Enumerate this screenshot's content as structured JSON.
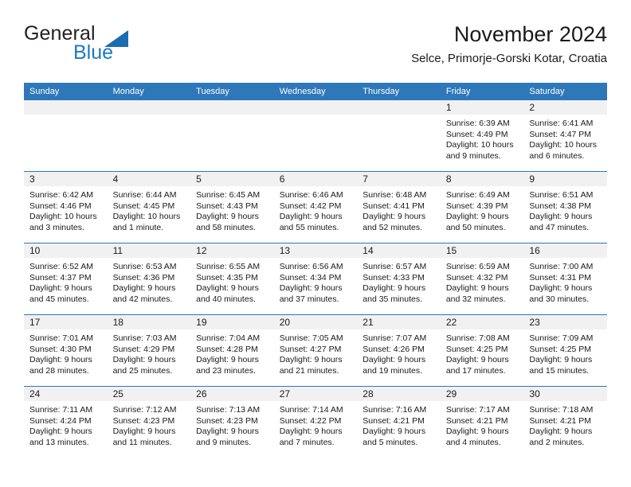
{
  "brand": {
    "name_part1": "General",
    "name_part2": "Blue",
    "triangle_color": "#1b6cb0",
    "text_color": "#231f20",
    "blue_color": "#1b78c3"
  },
  "header": {
    "title": "November 2024",
    "subtitle": "Selce, Primorje-Gorski Kotar, Croatia"
  },
  "theme": {
    "header_bg": "#2e78b9",
    "header_text": "#ffffff",
    "date_band_bg": "#f1f1f1",
    "cell_bg": "#ffffff",
    "row_divider": "#2e78b9",
    "body_text": "#1a1a1a"
  },
  "weekdays": [
    "Sunday",
    "Monday",
    "Tuesday",
    "Wednesday",
    "Thursday",
    "Friday",
    "Saturday"
  ],
  "weeks": [
    [
      {
        "date": "",
        "lines": []
      },
      {
        "date": "",
        "lines": []
      },
      {
        "date": "",
        "lines": []
      },
      {
        "date": "",
        "lines": []
      },
      {
        "date": "",
        "lines": []
      },
      {
        "date": "1",
        "lines": [
          "Sunrise: 6:39 AM",
          "Sunset: 4:49 PM",
          "Daylight: 10 hours",
          "and 9 minutes."
        ]
      },
      {
        "date": "2",
        "lines": [
          "Sunrise: 6:41 AM",
          "Sunset: 4:47 PM",
          "Daylight: 10 hours",
          "and 6 minutes."
        ]
      }
    ],
    [
      {
        "date": "3",
        "lines": [
          "Sunrise: 6:42 AM",
          "Sunset: 4:46 PM",
          "Daylight: 10 hours",
          "and 3 minutes."
        ]
      },
      {
        "date": "4",
        "lines": [
          "Sunrise: 6:44 AM",
          "Sunset: 4:45 PM",
          "Daylight: 10 hours",
          "and 1 minute."
        ]
      },
      {
        "date": "5",
        "lines": [
          "Sunrise: 6:45 AM",
          "Sunset: 4:43 PM",
          "Daylight: 9 hours",
          "and 58 minutes."
        ]
      },
      {
        "date": "6",
        "lines": [
          "Sunrise: 6:46 AM",
          "Sunset: 4:42 PM",
          "Daylight: 9 hours",
          "and 55 minutes."
        ]
      },
      {
        "date": "7",
        "lines": [
          "Sunrise: 6:48 AM",
          "Sunset: 4:41 PM",
          "Daylight: 9 hours",
          "and 52 minutes."
        ]
      },
      {
        "date": "8",
        "lines": [
          "Sunrise: 6:49 AM",
          "Sunset: 4:39 PM",
          "Daylight: 9 hours",
          "and 50 minutes."
        ]
      },
      {
        "date": "9",
        "lines": [
          "Sunrise: 6:51 AM",
          "Sunset: 4:38 PM",
          "Daylight: 9 hours",
          "and 47 minutes."
        ]
      }
    ],
    [
      {
        "date": "10",
        "lines": [
          "Sunrise: 6:52 AM",
          "Sunset: 4:37 PM",
          "Daylight: 9 hours",
          "and 45 minutes."
        ]
      },
      {
        "date": "11",
        "lines": [
          "Sunrise: 6:53 AM",
          "Sunset: 4:36 PM",
          "Daylight: 9 hours",
          "and 42 minutes."
        ]
      },
      {
        "date": "12",
        "lines": [
          "Sunrise: 6:55 AM",
          "Sunset: 4:35 PM",
          "Daylight: 9 hours",
          "and 40 minutes."
        ]
      },
      {
        "date": "13",
        "lines": [
          "Sunrise: 6:56 AM",
          "Sunset: 4:34 PM",
          "Daylight: 9 hours",
          "and 37 minutes."
        ]
      },
      {
        "date": "14",
        "lines": [
          "Sunrise: 6:57 AM",
          "Sunset: 4:33 PM",
          "Daylight: 9 hours",
          "and 35 minutes."
        ]
      },
      {
        "date": "15",
        "lines": [
          "Sunrise: 6:59 AM",
          "Sunset: 4:32 PM",
          "Daylight: 9 hours",
          "and 32 minutes."
        ]
      },
      {
        "date": "16",
        "lines": [
          "Sunrise: 7:00 AM",
          "Sunset: 4:31 PM",
          "Daylight: 9 hours",
          "and 30 minutes."
        ]
      }
    ],
    [
      {
        "date": "17",
        "lines": [
          "Sunrise: 7:01 AM",
          "Sunset: 4:30 PM",
          "Daylight: 9 hours",
          "and 28 minutes."
        ]
      },
      {
        "date": "18",
        "lines": [
          "Sunrise: 7:03 AM",
          "Sunset: 4:29 PM",
          "Daylight: 9 hours",
          "and 25 minutes."
        ]
      },
      {
        "date": "19",
        "lines": [
          "Sunrise: 7:04 AM",
          "Sunset: 4:28 PM",
          "Daylight: 9 hours",
          "and 23 minutes."
        ]
      },
      {
        "date": "20",
        "lines": [
          "Sunrise: 7:05 AM",
          "Sunset: 4:27 PM",
          "Daylight: 9 hours",
          "and 21 minutes."
        ]
      },
      {
        "date": "21",
        "lines": [
          "Sunrise: 7:07 AM",
          "Sunset: 4:26 PM",
          "Daylight: 9 hours",
          "and 19 minutes."
        ]
      },
      {
        "date": "22",
        "lines": [
          "Sunrise: 7:08 AM",
          "Sunset: 4:25 PM",
          "Daylight: 9 hours",
          "and 17 minutes."
        ]
      },
      {
        "date": "23",
        "lines": [
          "Sunrise: 7:09 AM",
          "Sunset: 4:25 PM",
          "Daylight: 9 hours",
          "and 15 minutes."
        ]
      }
    ],
    [
      {
        "date": "24",
        "lines": [
          "Sunrise: 7:11 AM",
          "Sunset: 4:24 PM",
          "Daylight: 9 hours",
          "and 13 minutes."
        ]
      },
      {
        "date": "25",
        "lines": [
          "Sunrise: 7:12 AM",
          "Sunset: 4:23 PM",
          "Daylight: 9 hours",
          "and 11 minutes."
        ]
      },
      {
        "date": "26",
        "lines": [
          "Sunrise: 7:13 AM",
          "Sunset: 4:23 PM",
          "Daylight: 9 hours",
          "and 9 minutes."
        ]
      },
      {
        "date": "27",
        "lines": [
          "Sunrise: 7:14 AM",
          "Sunset: 4:22 PM",
          "Daylight: 9 hours",
          "and 7 minutes."
        ]
      },
      {
        "date": "28",
        "lines": [
          "Sunrise: 7:16 AM",
          "Sunset: 4:21 PM",
          "Daylight: 9 hours",
          "and 5 minutes."
        ]
      },
      {
        "date": "29",
        "lines": [
          "Sunrise: 7:17 AM",
          "Sunset: 4:21 PM",
          "Daylight: 9 hours",
          "and 4 minutes."
        ]
      },
      {
        "date": "30",
        "lines": [
          "Sunrise: 7:18 AM",
          "Sunset: 4:21 PM",
          "Daylight: 9 hours",
          "and 2 minutes."
        ]
      }
    ]
  ]
}
